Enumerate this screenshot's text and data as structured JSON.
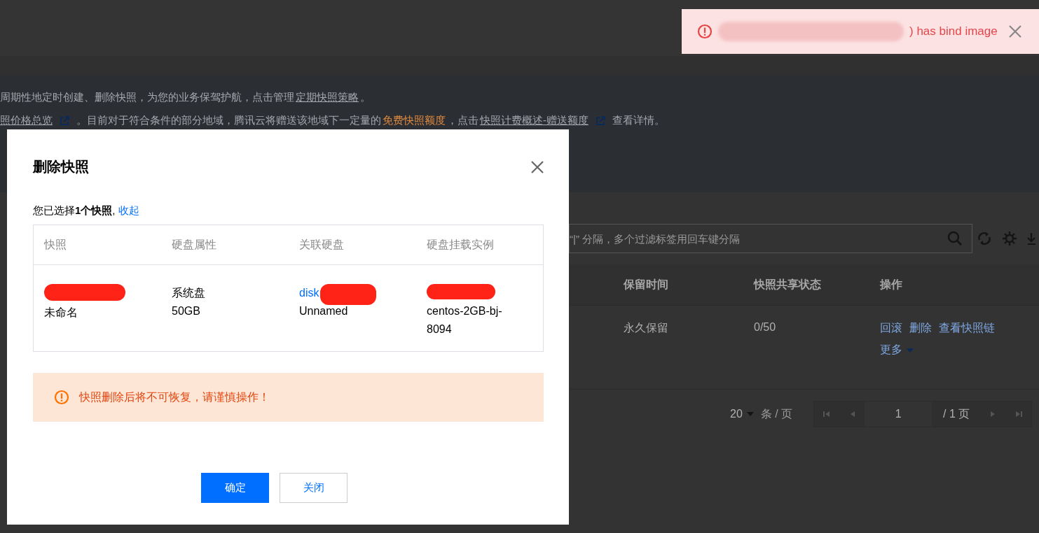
{
  "notification": {
    "redacted": true,
    "message": ") has bind image"
  },
  "notice": {
    "lines": [
      [
        {
          "kind": "text",
          "text": "周期性地定时创建、删除快照，为您的业务保驾护航，点击管理"
        },
        {
          "kind": "link",
          "text": "定期快照策略"
        },
        {
          "kind": "text",
          "text": "。"
        }
      ],
      [
        {
          "kind": "link",
          "text": "照价格总览"
        },
        {
          "kind": "external"
        },
        {
          "kind": "text",
          "text": "。目前对于符合条件的部分地域，腾讯云将赠送该地域下一定量的"
        },
        {
          "kind": "highlight",
          "text": "免费快照额度"
        },
        {
          "kind": "text",
          "text": "，点击"
        },
        {
          "kind": "link",
          "text": "快照计费概述-赠送额度"
        },
        {
          "kind": "external"
        },
        {
          "kind": "text",
          "text": "查看详情。"
        }
      ]
    ]
  },
  "search": {
    "placeholder": "“|” 分隔，多个过滤标签用回车键分隔"
  },
  "table": {
    "columns": [
      "保留时间",
      "快照共享状态",
      "操作"
    ],
    "rows": [
      {
        "retention": "永久保留",
        "share_status": "0/50",
        "actions": [
          "回滚",
          "删除",
          "查看快照链"
        ],
        "more": "更多"
      }
    ]
  },
  "pagination": {
    "page_size": "20",
    "per_page_label": "条 / 页",
    "page": "1",
    "total": "/ 1 页"
  },
  "dialog": {
    "title": "删除快照",
    "selection": "您已选择**1个快照**, ",
    "collapse_link": "收起",
    "columns": [
      "快照",
      "硬盘属性",
      "关联硬盘",
      "硬盘挂载实例"
    ],
    "rows": [
      {
        "snapshot": {
          "redacted": true,
          "name": "未命名"
        },
        "disk_type": [
          "系统盘",
          "50GB"
        ],
        "disk": {
          "link": "disk",
          "redacted": true,
          "name": "Unnamed"
        },
        "instance": {
          "redacted": true,
          "name": "centos-2GB-bj-8094"
        }
      }
    ],
    "warning": "快照删除后将不可恢复，请谨慎操作！",
    "buttons": [
      {
        "kind": "primary",
        "label": "确定"
      },
      {
        "kind": "secondary",
        "label": "关闭"
      }
    ]
  }
}
